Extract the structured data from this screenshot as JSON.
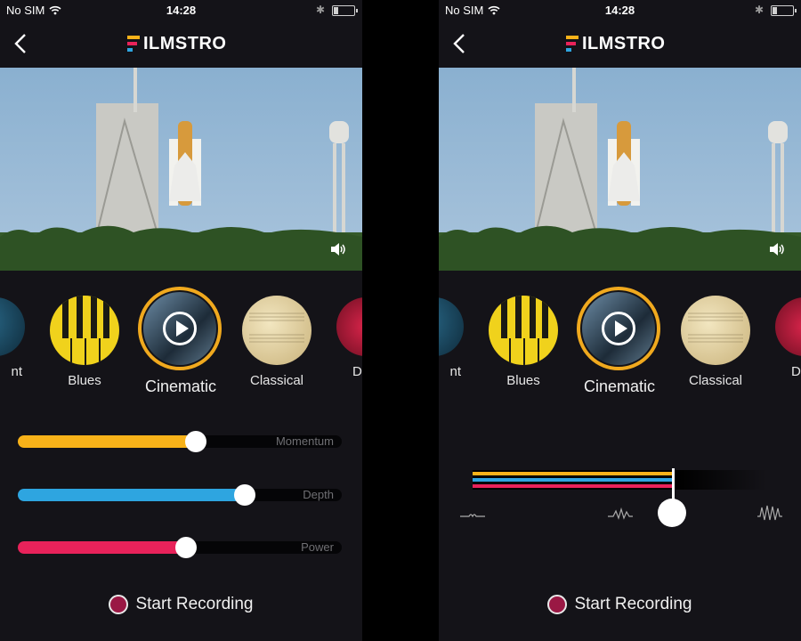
{
  "status_bar": {
    "carrier": "No SIM",
    "time": "14:28"
  },
  "app": {
    "logo_text": "ILMSTRO",
    "logo_letter": "F"
  },
  "genres": {
    "items": [
      {
        "label": "nt"
      },
      {
        "label": "Blues"
      },
      {
        "label": "Cinematic",
        "selected": true
      },
      {
        "label": "Classical"
      },
      {
        "label": "D"
      }
    ]
  },
  "sliders": [
    {
      "label": "Momentum",
      "value": 0.55,
      "color": "#f8b219"
    },
    {
      "label": "Depth",
      "value": 0.7,
      "color": "#2ea5e0"
    },
    {
      "label": "Power",
      "value": 0.52,
      "color": "#e8225a"
    }
  ],
  "record": {
    "label": "Start Recording"
  },
  "timeline": {
    "position": 0.68
  },
  "colors": {
    "accent": "#f0a91e",
    "momentum": "#f8b219",
    "depth": "#2ea5e0",
    "power": "#e8225a",
    "record": "#9a1844"
  }
}
